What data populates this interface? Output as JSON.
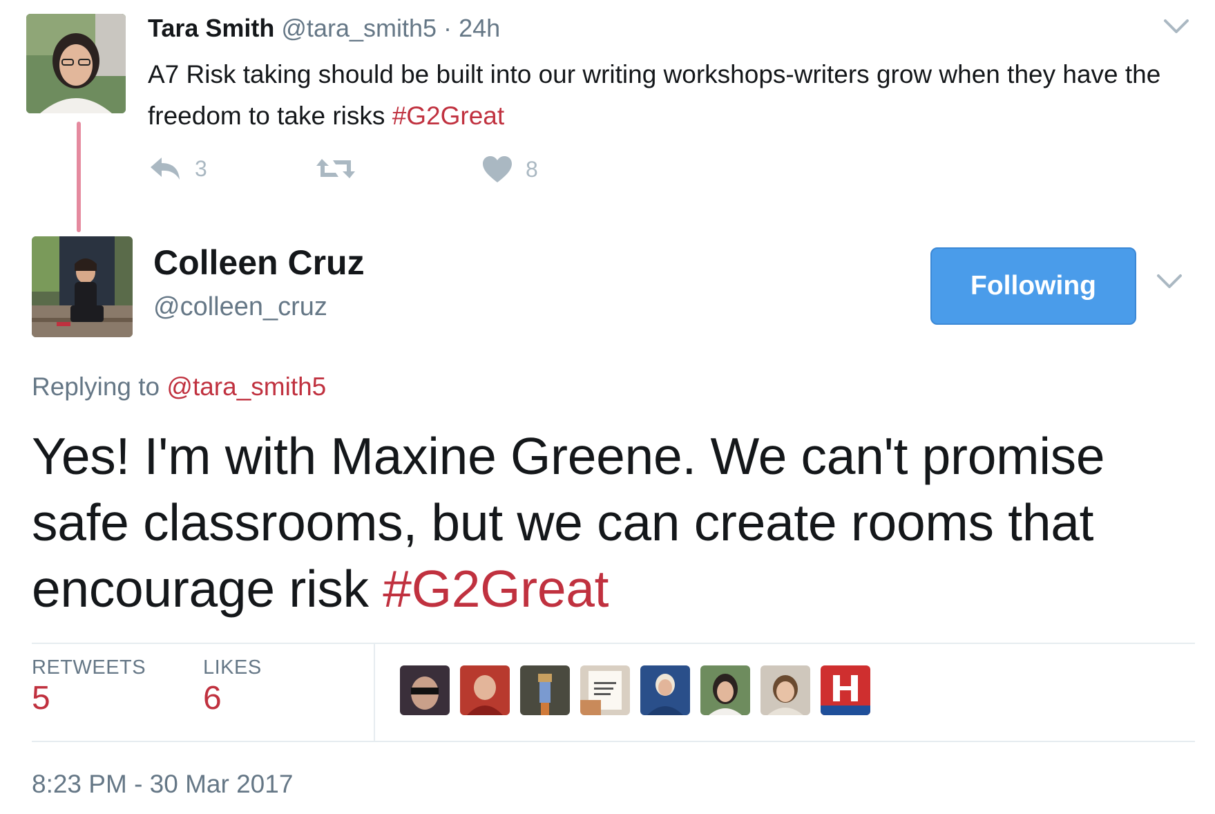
{
  "parent_tweet": {
    "name": "Tara Smith",
    "handle": "@tara_smith5",
    "separator": "·",
    "time": "24h",
    "text": "A7 Risk taking should be built into our writing workshops-writers grow when they have the freedom to take risks ",
    "hashtag": "#G2Great",
    "reply_count": "3",
    "retweet_count": "",
    "like_count": "8"
  },
  "reply_tweet": {
    "name": "Colleen Cruz",
    "handle": "@colleen_cruz",
    "follow_label": "Following",
    "replying_prefix": "Replying to ",
    "replying_to": "@tara_smith5",
    "text": "Yes! I'm with Maxine Greene. We can't promise safe classrooms, but we can create rooms that encourage risk ",
    "hashtag": "#G2Great",
    "retweets_label": "RETWEETS",
    "retweets_value": "5",
    "likes_label": "LIKES",
    "likes_value": "6",
    "timestamp": "8:23 PM - 30 Mar 2017"
  },
  "likers": [
    {
      "name": "liker-avatar-1",
      "color": "#3a2f3a"
    },
    {
      "name": "liker-avatar-2",
      "color": "#b83a2e"
    },
    {
      "name": "liker-avatar-3",
      "color": "#4a4a3f"
    },
    {
      "name": "liker-avatar-4",
      "color": "#d9cfc2"
    },
    {
      "name": "liker-avatar-5",
      "color": "#2a4f8a"
    },
    {
      "name": "liker-avatar-6",
      "color": "#2c2b2f"
    },
    {
      "name": "liker-avatar-7",
      "color": "#cfc7bc"
    },
    {
      "name": "liker-avatar-8",
      "color": "#cf2f2f"
    }
  ],
  "colors": {
    "accent_red": "#c0313f",
    "button_blue": "#4a9cea",
    "muted_gray": "#657786",
    "icon_gray": "#aab8c2",
    "thread_line": "#e58a9f"
  },
  "icons": {
    "caret": "chevron-down-icon",
    "reply": "reply-icon",
    "retweet": "retweet-icon",
    "like": "heart-icon"
  }
}
